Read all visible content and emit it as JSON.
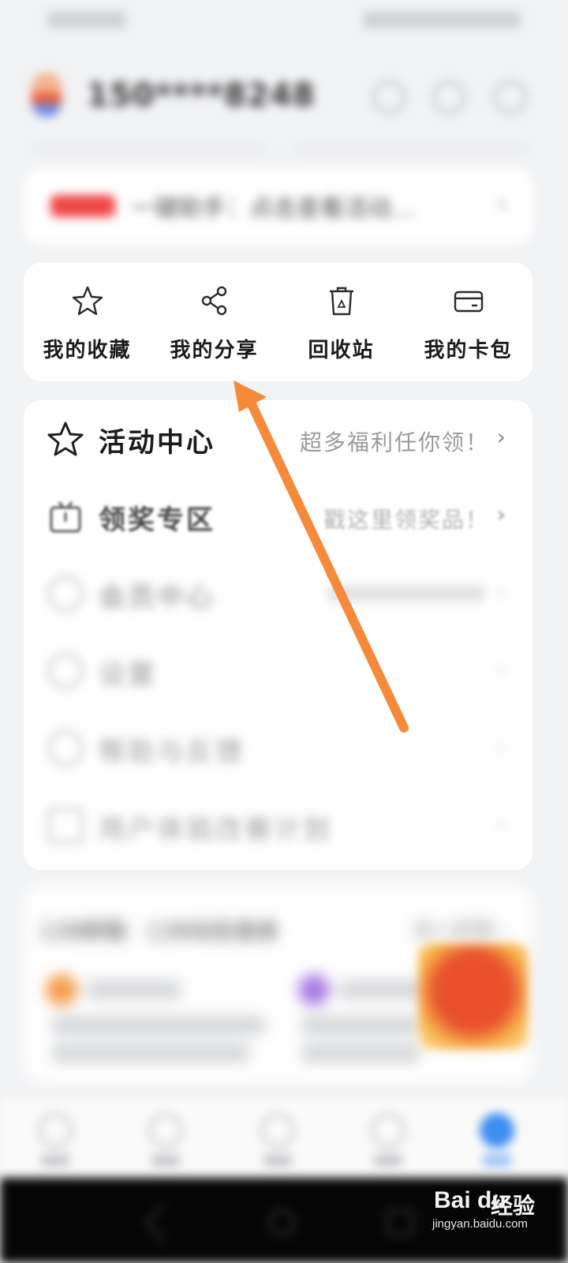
{
  "profile": {
    "username": "150****8248"
  },
  "notice": {
    "text": "一键助手：点击查看活动…"
  },
  "quick_actions": [
    {
      "label": "我的收藏",
      "icon": "star-icon"
    },
    {
      "label": "我的分享",
      "icon": "share-icon"
    },
    {
      "label": "回收站",
      "icon": "recycle-bin-icon"
    },
    {
      "label": "我的卡包",
      "icon": "card-wallet-icon"
    }
  ],
  "menu": [
    {
      "title": "活动中心",
      "subtitle": "超多福利任你领！",
      "icon": "star-outline-icon"
    },
    {
      "title": "领奖专区",
      "subtitle": "戳这里领奖品！",
      "icon": "gift-box-icon"
    },
    {
      "title": "会员中心",
      "subtitle": "",
      "icon": "member-icon"
    },
    {
      "title": "设置",
      "subtitle": "",
      "icon": "settings-icon"
    },
    {
      "title": "帮助与反馈",
      "subtitle": "",
      "icon": "help-icon"
    },
    {
      "title": "用户体验改善计划",
      "subtitle": "",
      "icon": "plan-icon"
    }
  ],
  "news": {
    "heading": "139邮箱 · 139动态速递",
    "more": "进入邮箱 ›"
  },
  "chevron": "›",
  "watermark": {
    "brand": "Bai du",
    "cn": "经验",
    "url": "jingyan.baidu.com"
  },
  "colors": {
    "arrow": "#f58a3a",
    "badge": "#ef4747",
    "card": "#ffffff",
    "background": "#f2f3f5"
  }
}
